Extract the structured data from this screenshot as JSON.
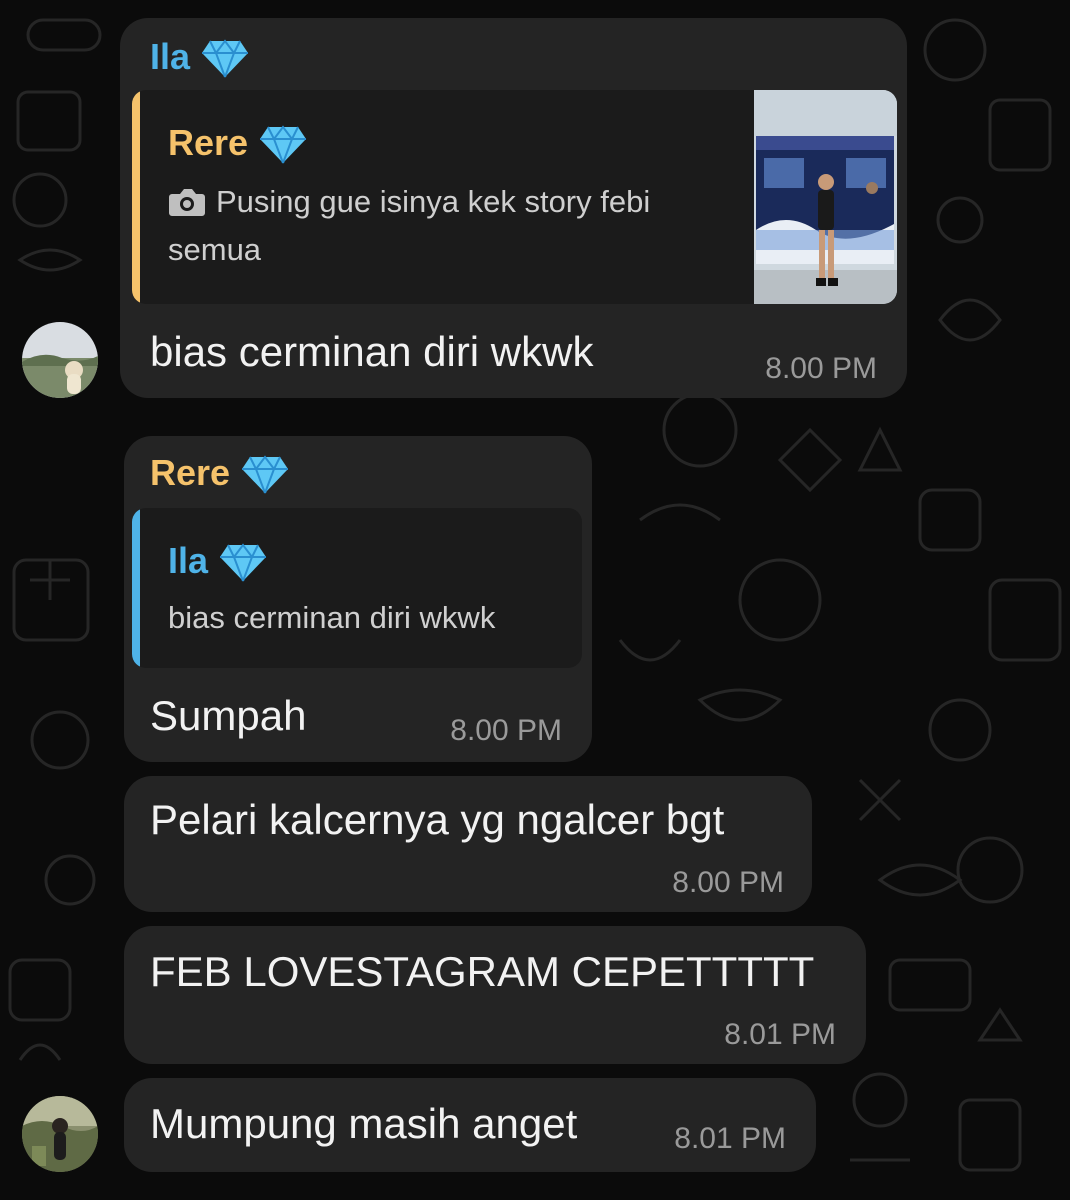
{
  "colors": {
    "background": "#0b0b0b",
    "bubble": "#242424",
    "quote_bg": "#1b1b1b",
    "ila_name": "#4fb3e8",
    "rere_name": "#f5c26b",
    "text": "#f2f2f2",
    "time": "#9a9a9a"
  },
  "messages": [
    {
      "sender": "Ila",
      "reply": {
        "sender": "Rere",
        "icon": "camera-icon",
        "text": "Pusing gue isinya kek story febi semua",
        "has_thumbnail": true
      },
      "text": "bias cerminan diri wkwk",
      "time": "8.00 PM"
    },
    {
      "sender": "Rere",
      "reply": {
        "sender": "Ila",
        "text": "bias cerminan diri wkwk"
      },
      "text": "Sumpah",
      "time": "8.00 PM"
    },
    {
      "text": "Pelari kalcernya yg ngalcer bgt",
      "time": "8.00 PM"
    },
    {
      "text": "FEB LOVESTAGRAM CEPETTTTT",
      "time": "8.01 PM"
    },
    {
      "text": "Mumpung masih anget",
      "time": "8.01 PM"
    }
  ]
}
